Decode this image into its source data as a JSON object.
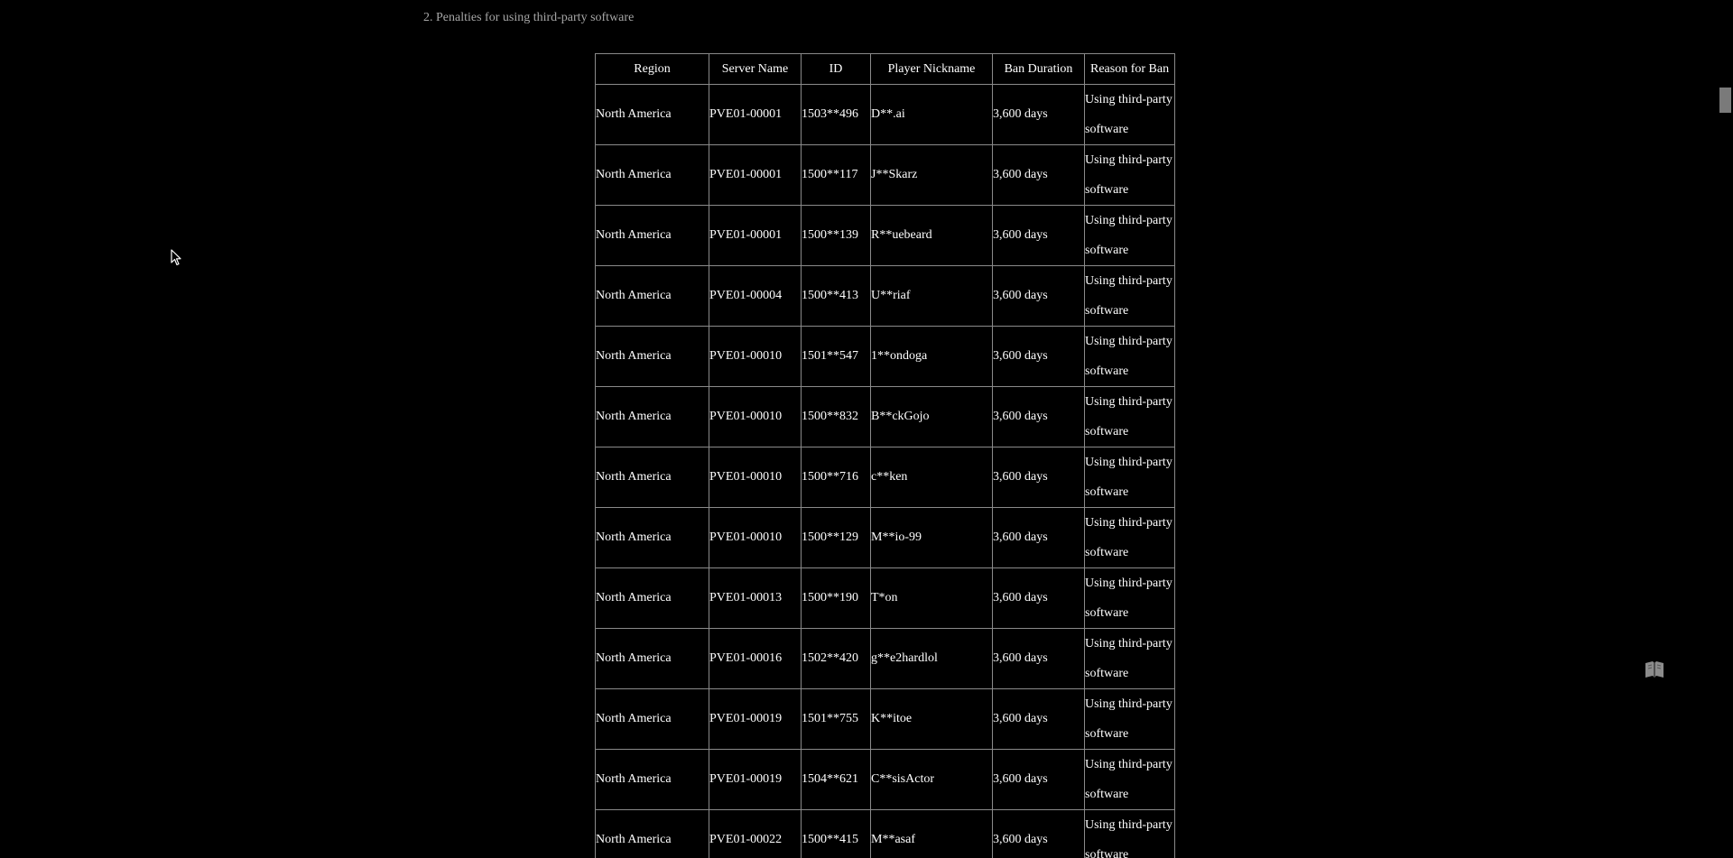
{
  "section": {
    "heading": "2. Penalties for using third-party software"
  },
  "table": {
    "headers": [
      "Region",
      "Server Name",
      "ID",
      "Player Nickname",
      "Ban Duration",
      "Reason for Ban"
    ],
    "rows": [
      [
        "North America",
        "PVE01-00001",
        "1503**496",
        "D**.ai",
        "3,600 days",
        "Using third-party software"
      ],
      [
        "North America",
        "PVE01-00001",
        "1500**117",
        "J**Skarz",
        "3,600 days",
        "Using third-party software"
      ],
      [
        "North America",
        "PVE01-00001",
        "1500**139",
        "R**uebeard",
        "3,600 days",
        "Using third-party software"
      ],
      [
        "North America",
        "PVE01-00004",
        "1500**413",
        "U**riaf",
        "3,600 days",
        "Using third-party software"
      ],
      [
        "North America",
        "PVE01-00010",
        "1501**547",
        "1**ondoga",
        "3,600 days",
        "Using third-party software"
      ],
      [
        "North America",
        "PVE01-00010",
        "1500**832",
        "B**ckGojo",
        "3,600 days",
        "Using third-party software"
      ],
      [
        "North America",
        "PVE01-00010",
        "1500**716",
        "c**ken",
        "3,600 days",
        "Using third-party software"
      ],
      [
        "North America",
        "PVE01-00010",
        "1500**129",
        "M**io-99",
        "3,600 days",
        "Using third-party software"
      ],
      [
        "North America",
        "PVE01-00013",
        "1500**190",
        "T*on",
        "3,600 days",
        "Using third-party software"
      ],
      [
        "North America",
        "PVE01-00016",
        "1502**420",
        "g**e2hardlol",
        "3,600 days",
        "Using third-party software"
      ],
      [
        "North America",
        "PVE01-00019",
        "1501**755",
        "K**itoe",
        "3,600 days",
        "Using third-party software"
      ],
      [
        "North America",
        "PVE01-00019",
        "1504**621",
        "C**sisActor",
        "3,600 days",
        "Using third-party software"
      ],
      [
        "North America",
        "PVE01-00022",
        "1500**415",
        "M**asaf",
        "3,600 days",
        "Using third-party software"
      ]
    ]
  },
  "icons": {
    "cursor": "mouse-pointer-icon",
    "floating": "book-icon"
  }
}
